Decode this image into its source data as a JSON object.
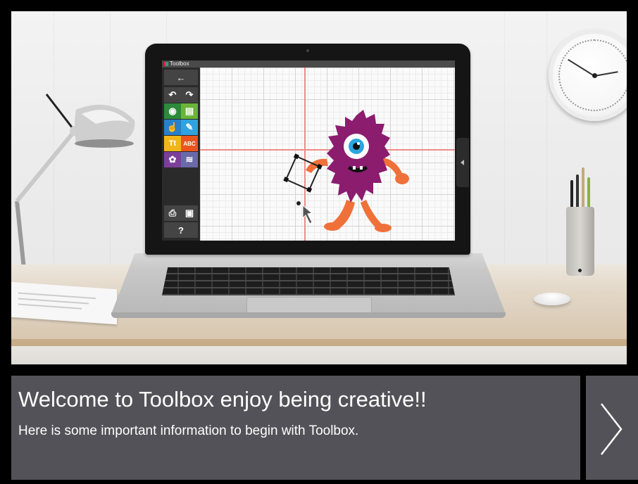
{
  "app": {
    "window_title": "Toolbox"
  },
  "info_panel": {
    "title": "Welcome to Toolbox enjoy being creative!!",
    "text": "Here is some important information to begin with Toolbox."
  },
  "navigation": {
    "next_icon": "chevron-right-icon"
  },
  "toolbox": {
    "tools": [
      {
        "name": "back-arrow-icon",
        "glyph": "←"
      },
      {
        "name": "undo-icon",
        "glyph": "↶"
      },
      {
        "name": "redo-icon",
        "glyph": "↷"
      },
      {
        "name": "view-icon",
        "glyph": "◉"
      },
      {
        "name": "new-page-icon",
        "glyph": "▤"
      },
      {
        "name": "hand-icon",
        "glyph": "☝"
      },
      {
        "name": "stamp-icon",
        "glyph": "✎"
      },
      {
        "name": "text-icon",
        "glyph": "Tt"
      },
      {
        "name": "monogram-icon",
        "glyph": "ABC"
      },
      {
        "name": "palette-icon",
        "glyph": "✿"
      },
      {
        "name": "layers-icon",
        "glyph": "≋"
      },
      {
        "name": "print-icon",
        "glyph": "⎙"
      },
      {
        "name": "save-icon",
        "glyph": "▣"
      },
      {
        "name": "help-icon",
        "glyph": "?"
      }
    ]
  },
  "colors": {
    "panel": "#525258",
    "frame": "#000000",
    "monster_body": "#8b1c6e",
    "monster_limbs": "#f0703a",
    "guide_line": "#f08a8a"
  }
}
